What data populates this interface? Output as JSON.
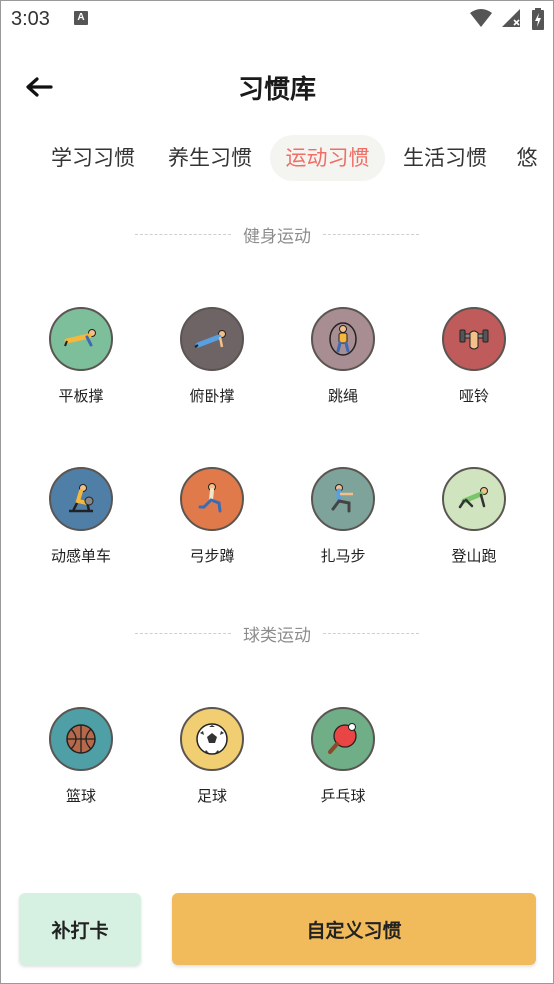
{
  "status_bar": {
    "time": "3:03",
    "notification_glyph": "A",
    "icons": [
      "wifi-icon",
      "cellular-icon",
      "battery-charging-icon"
    ]
  },
  "header": {
    "title": "习惯库",
    "back_icon": "arrow-left-icon"
  },
  "tabs": [
    {
      "label": "学习习惯",
      "active": false
    },
    {
      "label": "养生习惯",
      "active": false
    },
    {
      "label": "运动习惯",
      "active": true
    },
    {
      "label": "生活习惯",
      "active": false
    },
    {
      "label": "悠",
      "active": false
    }
  ],
  "sections": [
    {
      "title": "健身运动",
      "habits": [
        {
          "label": "平板撑",
          "icon": "plank-icon",
          "color": "#7dbf9a"
        },
        {
          "label": "俯卧撑",
          "icon": "pushup-icon",
          "color": "#6e6365"
        },
        {
          "label": "跳绳",
          "icon": "jump-rope-icon",
          "color": "#a88e92"
        },
        {
          "label": "哑铃",
          "icon": "dumbbell-icon",
          "color": "#bf5b5b"
        },
        {
          "label": "动感单车",
          "icon": "spin-bike-icon",
          "color": "#4f7fa6"
        },
        {
          "label": "弓步蹲",
          "icon": "lunge-icon",
          "color": "#e07a4a"
        },
        {
          "label": "扎马步",
          "icon": "squat-icon",
          "color": "#7ea39a"
        },
        {
          "label": "登山跑",
          "icon": "mountain-climber-icon",
          "color": "#cfe4bf"
        }
      ]
    },
    {
      "title": "球类运动",
      "habits": [
        {
          "label": "篮球",
          "icon": "basketball-icon",
          "color": "#4f9fa6"
        },
        {
          "label": "足球",
          "icon": "soccer-ball-icon",
          "color": "#f1ce72"
        },
        {
          "label": "乒乓球",
          "icon": "ping-pong-icon",
          "color": "#6fae86"
        }
      ]
    }
  ],
  "buttons": {
    "makeup_label": "补打卡",
    "custom_label": "自定义习惯"
  },
  "colors": {
    "active_tab_text": "#ef6f66",
    "active_tab_bg": "#f4f4f1",
    "makeup_bg": "#d6f0e2",
    "custom_bg": "#f1bb5c"
  }
}
